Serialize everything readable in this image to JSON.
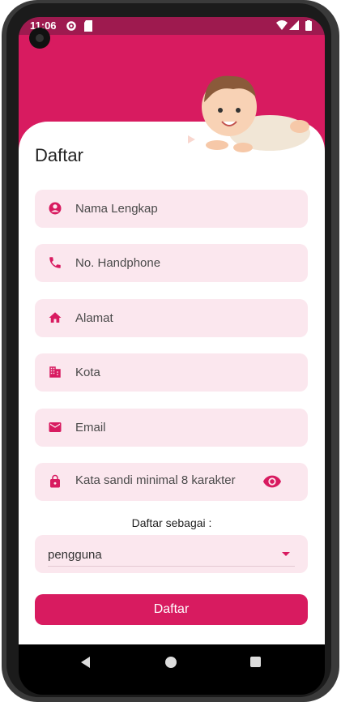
{
  "status_bar": {
    "time": "11:06"
  },
  "page": {
    "title": "Daftar"
  },
  "form": {
    "fields": [
      {
        "placeholder": "Nama Lengkap",
        "icon": "person-icon"
      },
      {
        "placeholder": "No. Handphone",
        "icon": "phone-icon"
      },
      {
        "placeholder": "Alamat",
        "icon": "home-icon"
      },
      {
        "placeholder": "Kota",
        "icon": "building-icon"
      },
      {
        "placeholder": "Email",
        "icon": "email-icon"
      },
      {
        "placeholder": "Kata sandi minimal 8 karakter",
        "icon": "lock-icon"
      }
    ],
    "role_prompt": "Daftar sebagai :",
    "role_value": "pengguna",
    "submit_label": "Daftar"
  },
  "colors": {
    "primary": "#d81b60",
    "field_bg": "#fbe7ee",
    "status": "#9e1a4f"
  }
}
